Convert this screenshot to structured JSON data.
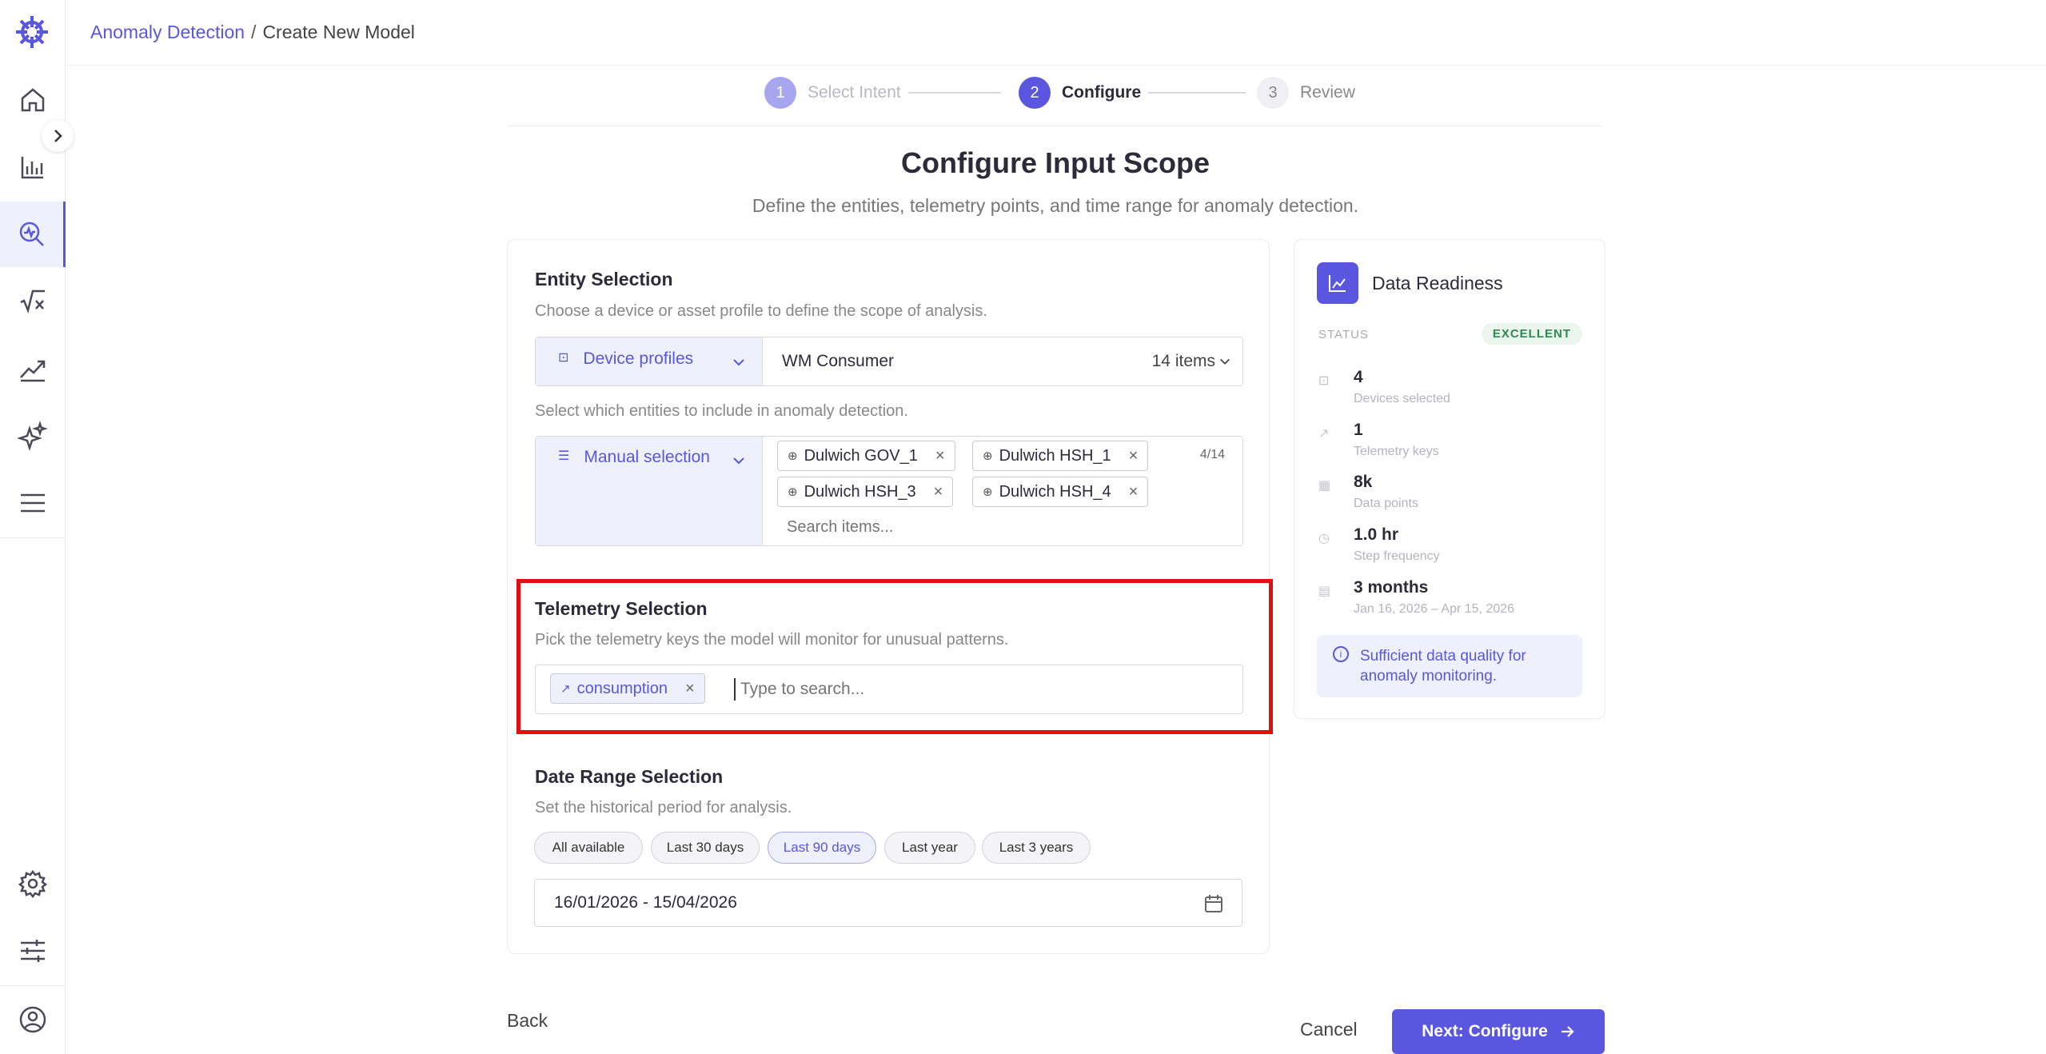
{
  "breadcrumb": {
    "parent": "Anomaly Detection",
    "separator": "/",
    "current": "Create New Model"
  },
  "stepper": [
    {
      "num": "1",
      "label": "Select Intent"
    },
    {
      "num": "2",
      "label": "Configure"
    },
    {
      "num": "3",
      "label": "Review"
    }
  ],
  "page": {
    "title": "Configure Input Scope",
    "subtitle": "Define the entities, telemetry points, and time range for anomaly detection."
  },
  "entity": {
    "title": "Entity Selection",
    "desc": "Choose a device or asset profile to define the scope of analysis.",
    "profile_type": "Device profiles",
    "profile_value": "WM Consumer",
    "profile_count": "14 items",
    "select_desc": "Select which entities to include in anomaly detection.",
    "selection_mode": "Manual selection",
    "selected_count": "4/14",
    "chips": [
      "Dulwich GOV_1",
      "Dulwich HSH_1",
      "Dulwich HSH_3",
      "Dulwich HSH_4"
    ],
    "search_placeholder": "Search items..."
  },
  "telemetry": {
    "title": "Telemetry Selection",
    "desc": "Pick the telemetry keys the model will monitor for unusual patterns.",
    "chip": "consumption",
    "placeholder": "Type to search..."
  },
  "date_range": {
    "title": "Date Range Selection",
    "desc": "Set the historical period for analysis.",
    "presets": [
      "All available",
      "Last 30 days",
      "Last 90 days",
      "Last year",
      "Last 3 years"
    ],
    "active_preset": "Last 90 days",
    "value": "16/01/2026 - 15/04/2026"
  },
  "readiness": {
    "title": "Data Readiness",
    "status_label": "STATUS",
    "status": "EXCELLENT",
    "metrics": [
      {
        "value": "4",
        "label": "Devices selected",
        "icon": "device-icon"
      },
      {
        "value": "1",
        "label": "Telemetry keys",
        "icon": "trend-icon"
      },
      {
        "value": "8k",
        "label": "Data points",
        "icon": "grid-icon"
      },
      {
        "value": "1.0 hr",
        "label": "Step frequency",
        "icon": "clock-icon"
      },
      {
        "value": "3 months",
        "label": "Jan 16, 2026 – Apr 15, 2026",
        "icon": "calendar-icon"
      }
    ],
    "info": "Sufficient data quality for anomaly monitoring."
  },
  "footer": {
    "back": "Back",
    "cancel": "Cancel",
    "next": "Next: Configure"
  },
  "colors": {
    "accent": "#5a56e0",
    "highlight": "#e50e0e",
    "success": "#2e8b4e"
  }
}
